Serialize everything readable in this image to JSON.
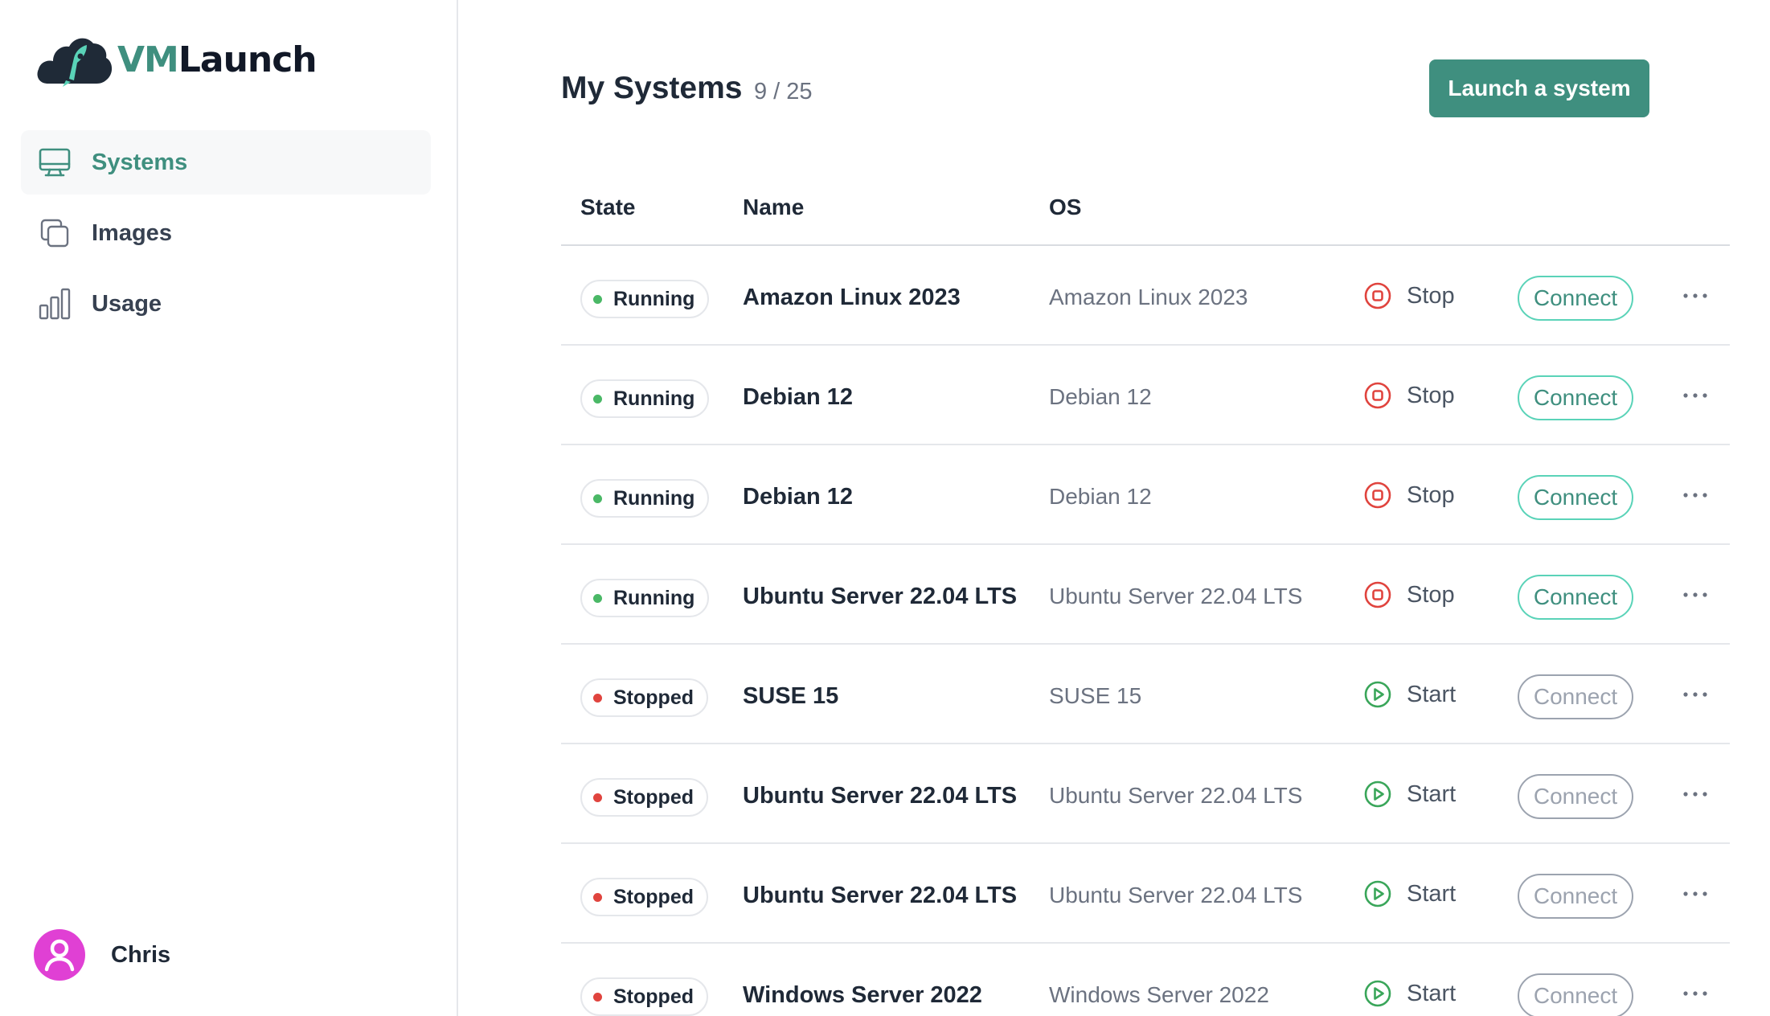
{
  "brand": {
    "part1": "VM",
    "part2": "Launch",
    "accent": "#3f8f7f"
  },
  "sidebar": {
    "items": [
      {
        "label": "Systems",
        "icon": "monitor-icon",
        "active": true
      },
      {
        "label": "Images",
        "icon": "copy-icon",
        "active": false
      },
      {
        "label": "Usage",
        "icon": "bar-chart-icon",
        "active": false
      }
    ],
    "user": {
      "name": "Chris",
      "avatar_color": "#e040d4"
    }
  },
  "header": {
    "title": "My Systems",
    "count": "9 / 25",
    "launch_label": "Launch a system"
  },
  "table": {
    "columns": {
      "state": "State",
      "name": "Name",
      "os": "OS"
    },
    "rows": [
      {
        "state": "Running",
        "name": "Amazon Linux 2023",
        "os": "Amazon Linux 2023",
        "action": "Stop",
        "connect": "Connect"
      },
      {
        "state": "Running",
        "name": "Debian 12",
        "os": "Debian 12",
        "action": "Stop",
        "connect": "Connect"
      },
      {
        "state": "Running",
        "name": "Debian 12",
        "os": "Debian 12",
        "action": "Stop",
        "connect": "Connect"
      },
      {
        "state": "Running",
        "name": "Ubuntu Server 22.04 LTS",
        "os": "Ubuntu Server 22.04 LTS",
        "action": "Stop",
        "connect": "Connect"
      },
      {
        "state": "Stopped",
        "name": "SUSE 15",
        "os": "SUSE 15",
        "action": "Start",
        "connect": "Connect"
      },
      {
        "state": "Stopped",
        "name": "Ubuntu Server 22.04 LTS",
        "os": "Ubuntu Server 22.04 LTS",
        "action": "Start",
        "connect": "Connect"
      },
      {
        "state": "Stopped",
        "name": "Ubuntu Server 22.04 LTS",
        "os": "Ubuntu Server 22.04 LTS",
        "action": "Start",
        "connect": "Connect"
      },
      {
        "state": "Stopped",
        "name": "Windows Server 2022",
        "os": "Windows Server 2022",
        "action": "Start",
        "connect": "Connect"
      }
    ]
  },
  "colors": {
    "running_dot": "#4ab866",
    "stopped_dot": "#e0443e",
    "stop_icon": "#e0443e",
    "start_icon": "#3aa65a"
  }
}
